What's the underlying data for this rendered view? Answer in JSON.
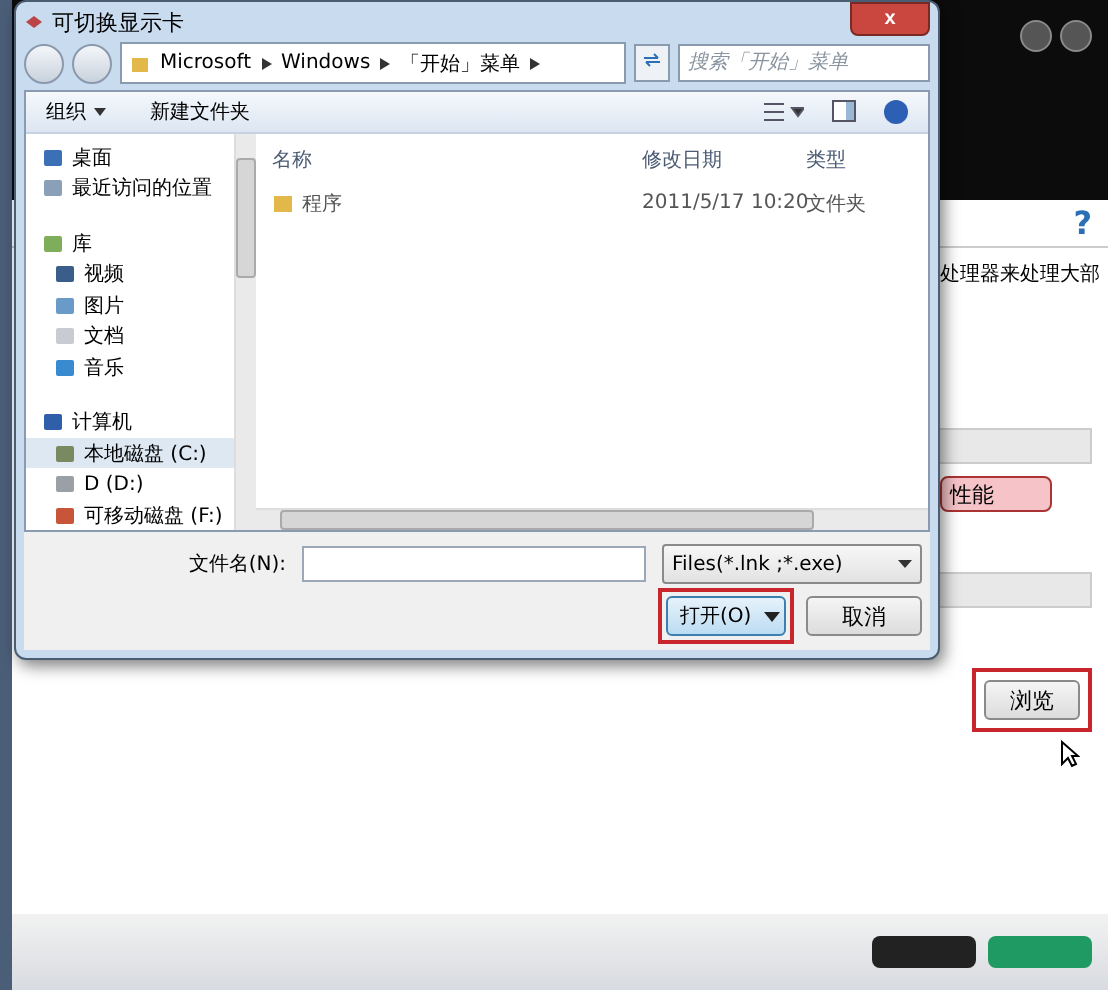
{
  "background_app": {
    "help": "?",
    "description": "处理器来处理大部",
    "performance_button": "性能",
    "browse_button": "浏览",
    "highlighted": true
  },
  "dialog": {
    "title": "可切换显示卡",
    "close": "x",
    "breadcrumbs": [
      "Microsoft",
      "Windows",
      "「开始」菜单"
    ],
    "search": {
      "placeholder": "搜索「开始」菜单"
    },
    "toolbar": [
      {
        "label": "组织",
        "kind": "menu"
      },
      {
        "label": "新建文件夹",
        "kind": "plain"
      }
    ],
    "nav": [
      {
        "label": "桌面",
        "selected": false
      },
      {
        "label": "最近访问的位置",
        "selected": false
      },
      {
        "label": "库",
        "selected": false,
        "children": [
          {
            "label": "视频",
            "selected": false
          },
          {
            "label": "图片",
            "selected": false
          },
          {
            "label": "文档",
            "selected": false
          },
          {
            "label": "音乐",
            "selected": false
          }
        ]
      },
      {
        "label": "计算机",
        "selected": false,
        "children": [
          {
            "label": "本地磁盘 (C:)",
            "selected": true
          },
          {
            "label": "D (D:)",
            "selected": false
          },
          {
            "label": "可移动磁盘 (F:)",
            "selected": false
          }
        ]
      }
    ],
    "columns": [
      "名称",
      "修改日期",
      "类型"
    ],
    "rows": [
      {
        "name": "程序",
        "date": "2011/5/17 10:20",
        "type": "文件夹",
        "selected": false
      }
    ],
    "filename_label": "文件名(N):",
    "filter": "Files(*.lnk ;*.exe)",
    "open_button": "打开(O)",
    "cancel_button": "取消",
    "open_highlighted": true
  }
}
